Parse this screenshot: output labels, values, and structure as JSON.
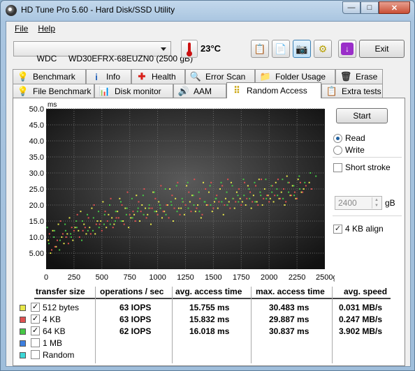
{
  "window": {
    "title": "HD Tune Pro 5.60 - Hard Disk/SSD Utility",
    "minimize_glyph": "—",
    "maximize_glyph": "□",
    "close_glyph": "✕"
  },
  "menu": {
    "file": "File",
    "help": "Help"
  },
  "toolbar": {
    "drive": "WDC     WD30EFRX-68EUZN0 (2500 gB)",
    "temperature": "23°C",
    "exit_label": "Exit",
    "buttons": [
      "copy-info-icon",
      "copy-screen-icon",
      "camera-icon",
      "options-icon",
      "download-icon"
    ]
  },
  "tabs_top": [
    {
      "label": "Benchmark",
      "icon": "benchmark-icon"
    },
    {
      "label": "Info",
      "icon": "info-icon"
    },
    {
      "label": "Health",
      "icon": "health-icon"
    },
    {
      "label": "Error Scan",
      "icon": "error-scan-icon"
    },
    {
      "label": "Folder Usage",
      "icon": "folder-icon"
    },
    {
      "label": "Erase",
      "icon": "trash-icon"
    }
  ],
  "tabs_bottom": [
    {
      "label": "File Benchmark",
      "icon": "file-benchmark-icon"
    },
    {
      "label": "Disk monitor",
      "icon": "disk-monitor-icon"
    },
    {
      "label": "AAM",
      "icon": "speaker-icon"
    },
    {
      "label": "Random Access",
      "icon": "random-access-icon",
      "selected": true
    },
    {
      "label": "Extra tests",
      "icon": "extra-tests-icon"
    }
  ],
  "controls": {
    "start_label": "Start",
    "read_label": "Read",
    "write_label": "Write",
    "mode": "Read",
    "short_stroke_label": "Short stroke",
    "short_stroke_checked": false,
    "short_stroke_value": "2400",
    "short_stroke_unit": "gB",
    "align_label": "4 KB align",
    "align_checked": true
  },
  "table": {
    "headers": {
      "transfer_size": "transfer size",
      "ops": "operations / sec",
      "avg_access": "avg. access time",
      "max_access": "max. access time",
      "avg_speed": "avg. speed"
    },
    "rows": [
      {
        "label": "512 bytes",
        "checked": true,
        "color": "#e8e84a",
        "ops": "63 IOPS",
        "avg": "15.755 ms",
        "max": "30.483 ms",
        "speed": "0.031 MB/s"
      },
      {
        "label": "4 KB",
        "checked": true,
        "color": "#e05050",
        "ops": "63 IOPS",
        "avg": "15.832 ms",
        "max": "29.887 ms",
        "speed": "0.247 MB/s"
      },
      {
        "label": "64 KB",
        "checked": true,
        "color": "#46c846",
        "ops": "62 IOPS",
        "avg": "16.018 ms",
        "max": "30.837 ms",
        "speed": "3.902 MB/s"
      },
      {
        "label": "1 MB",
        "checked": false,
        "color": "#3c7fe0",
        "ops": "",
        "avg": "",
        "max": "",
        "speed": ""
      },
      {
        "label": "Random",
        "checked": false,
        "color": "#3cd8d8",
        "ops": "",
        "avg": "",
        "max": "",
        "speed": ""
      }
    ]
  },
  "chart_data": {
    "type": "scatter",
    "y_unit": "ms",
    "x_unit": "gB",
    "ylim": [
      0,
      50
    ],
    "xlim": [
      0,
      2500
    ],
    "y_ticks": [
      "50.0",
      "45.0",
      "40.0",
      "35.0",
      "30.0",
      "25.0",
      "20.0",
      "15.0",
      "10.0",
      "5.00"
    ],
    "x_ticks": [
      "0",
      "250",
      "500",
      "750",
      "1000",
      "1250",
      "1500",
      "1750",
      "2000",
      "2250",
      "2500gB"
    ],
    "grid": true,
    "series": [
      {
        "color": "#e8e84a",
        "points": [
          [
            20,
            9
          ],
          [
            60,
            12
          ],
          [
            110,
            14
          ],
          [
            160,
            8
          ],
          [
            210,
            16
          ],
          [
            260,
            13
          ],
          [
            310,
            18
          ],
          [
            360,
            11
          ],
          [
            410,
            19
          ],
          [
            460,
            15
          ],
          [
            510,
            21
          ],
          [
            560,
            17
          ],
          [
            610,
            14
          ],
          [
            660,
            22
          ],
          [
            710,
            19
          ],
          [
            760,
            16
          ],
          [
            810,
            23
          ],
          [
            860,
            20
          ],
          [
            910,
            17
          ],
          [
            960,
            24
          ],
          [
            1010,
            21
          ],
          [
            1060,
            18
          ],
          [
            1110,
            25
          ],
          [
            1160,
            22
          ],
          [
            1210,
            19
          ],
          [
            1260,
            26
          ],
          [
            1310,
            23
          ],
          [
            1360,
            20
          ],
          [
            1410,
            27
          ],
          [
            1460,
            24
          ],
          [
            1510,
            21
          ],
          [
            1560,
            25
          ],
          [
            1610,
            22
          ],
          [
            1660,
            27
          ],
          [
            1710,
            24
          ],
          [
            1760,
            21
          ],
          [
            1810,
            26
          ],
          [
            1860,
            23
          ],
          [
            1910,
            28
          ],
          [
            1960,
            25
          ],
          [
            2010,
            22
          ],
          [
            2060,
            27
          ],
          [
            2110,
            24
          ],
          [
            2160,
            29
          ],
          [
            2210,
            26
          ],
          [
            2260,
            28
          ],
          [
            2310,
            25
          ],
          [
            2360,
            27
          ],
          [
            40,
            5
          ],
          [
            90,
            7
          ],
          [
            140,
            10
          ],
          [
            190,
            11
          ],
          [
            240,
            9
          ],
          [
            290,
            12
          ],
          [
            340,
            14
          ],
          [
            390,
            13
          ],
          [
            440,
            11
          ],
          [
            490,
            15
          ],
          [
            540,
            13
          ],
          [
            590,
            16
          ],
          [
            640,
            18
          ],
          [
            690,
            15
          ],
          [
            740,
            13
          ],
          [
            790,
            17
          ],
          [
            840,
            15
          ],
          [
            890,
            19
          ],
          [
            940,
            14
          ],
          [
            990,
            18
          ],
          [
            1040,
            16
          ],
          [
            1090,
            20
          ],
          [
            1140,
            15
          ],
          [
            1190,
            19
          ],
          [
            1240,
            17
          ],
          [
            1290,
            21
          ],
          [
            1340,
            18
          ],
          [
            1390,
            16
          ],
          [
            1440,
            20
          ],
          [
            1490,
            18
          ],
          [
            1540,
            19
          ],
          [
            1590,
            17
          ],
          [
            1640,
            21
          ],
          [
            1690,
            19
          ],
          [
            1740,
            22
          ],
          [
            1790,
            20
          ],
          [
            1840,
            19
          ],
          [
            1890,
            21
          ],
          [
            1940,
            20
          ],
          [
            1990,
            23
          ],
          [
            2040,
            21
          ],
          [
            2090,
            22
          ],
          [
            2140,
            20
          ],
          [
            2190,
            23
          ],
          [
            2240,
            22
          ],
          [
            2290,
            24
          ]
        ]
      },
      {
        "color": "#e05050",
        "points": [
          [
            30,
            11
          ],
          [
            80,
            7
          ],
          [
            130,
            15
          ],
          [
            180,
            10
          ],
          [
            230,
            13
          ],
          [
            280,
            17
          ],
          [
            330,
            12
          ],
          [
            380,
            16
          ],
          [
            430,
            20
          ],
          [
            480,
            14
          ],
          [
            530,
            18
          ],
          [
            580,
            22
          ],
          [
            630,
            16
          ],
          [
            680,
            20
          ],
          [
            730,
            24
          ],
          [
            780,
            18
          ],
          [
            830,
            21
          ],
          [
            880,
            25
          ],
          [
            930,
            19
          ],
          [
            980,
            22
          ],
          [
            1030,
            26
          ],
          [
            1080,
            20
          ],
          [
            1130,
            23
          ],
          [
            1180,
            27
          ],
          [
            1230,
            21
          ],
          [
            1280,
            24
          ],
          [
            1330,
            28
          ],
          [
            1380,
            22
          ],
          [
            1430,
            25
          ],
          [
            1480,
            27
          ],
          [
            1530,
            23
          ],
          [
            1580,
            26
          ],
          [
            1630,
            28
          ],
          [
            1680,
            22
          ],
          [
            1730,
            25
          ],
          [
            1780,
            27
          ],
          [
            1830,
            24
          ],
          [
            1880,
            26
          ],
          [
            1930,
            28
          ],
          [
            1980,
            23
          ],
          [
            2030,
            26
          ],
          [
            2080,
            28
          ],
          [
            2130,
            25
          ],
          [
            2180,
            27
          ],
          [
            2230,
            24
          ],
          [
            2280,
            27
          ],
          [
            2330,
            26
          ],
          [
            2380,
            25
          ],
          [
            50,
            6
          ],
          [
            100,
            9
          ],
          [
            150,
            11
          ],
          [
            200,
            8
          ],
          [
            250,
            12
          ],
          [
            300,
            10
          ],
          [
            350,
            13
          ],
          [
            400,
            11
          ],
          [
            450,
            14
          ],
          [
            500,
            12
          ],
          [
            550,
            15
          ],
          [
            600,
            13
          ],
          [
            650,
            16
          ],
          [
            700,
            14
          ],
          [
            750,
            17
          ],
          [
            800,
            15
          ],
          [
            850,
            18
          ],
          [
            900,
            16
          ],
          [
            950,
            19
          ],
          [
            1000,
            17
          ],
          [
            1050,
            18
          ],
          [
            1100,
            16
          ],
          [
            1150,
            19
          ],
          [
            1200,
            17
          ],
          [
            1250,
            20
          ],
          [
            1300,
            18
          ],
          [
            1350,
            19
          ],
          [
            1400,
            17
          ],
          [
            1450,
            20
          ],
          [
            1500,
            19
          ],
          [
            1550,
            21
          ],
          [
            1600,
            20
          ],
          [
            1650,
            19
          ],
          [
            1700,
            21
          ],
          [
            1750,
            20
          ],
          [
            1800,
            22
          ],
          [
            1850,
            21
          ],
          [
            1900,
            20
          ],
          [
            1950,
            22
          ],
          [
            2000,
            21
          ],
          [
            2050,
            23
          ],
          [
            2100,
            22
          ],
          [
            2150,
            21
          ],
          [
            2200,
            23
          ],
          [
            2250,
            22
          ],
          [
            2300,
            24
          ]
        ]
      },
      {
        "color": "#46c846",
        "points": [
          [
            10,
            13
          ],
          [
            70,
            10
          ],
          [
            120,
            6
          ],
          [
            170,
            14
          ],
          [
            220,
            11
          ],
          [
            270,
            15
          ],
          [
            320,
            9
          ],
          [
            370,
            17
          ],
          [
            420,
            12
          ],
          [
            470,
            18
          ],
          [
            520,
            14
          ],
          [
            570,
            20
          ],
          [
            620,
            15
          ],
          [
            670,
            21
          ],
          [
            720,
            17
          ],
          [
            770,
            22
          ],
          [
            820,
            18
          ],
          [
            870,
            23
          ],
          [
            920,
            19
          ],
          [
            970,
            24
          ],
          [
            1020,
            20
          ],
          [
            1070,
            25
          ],
          [
            1120,
            21
          ],
          [
            1170,
            26
          ],
          [
            1220,
            22
          ],
          [
            1270,
            27
          ],
          [
            1320,
            23
          ],
          [
            1370,
            24
          ],
          [
            1420,
            21
          ],
          [
            1470,
            26
          ],
          [
            1520,
            22
          ],
          [
            1570,
            27
          ],
          [
            1620,
            24
          ],
          [
            1670,
            26
          ],
          [
            1720,
            23
          ],
          [
            1770,
            28
          ],
          [
            1820,
            25
          ],
          [
            1870,
            27
          ],
          [
            1920,
            24
          ],
          [
            1970,
            28
          ],
          [
            2020,
            26
          ],
          [
            2070,
            25
          ],
          [
            2120,
            28
          ],
          [
            2170,
            27
          ],
          [
            2220,
            26
          ],
          [
            2270,
            29
          ],
          [
            2320,
            27
          ],
          [
            2370,
            30
          ],
          [
            2420,
            29
          ],
          [
            25,
            8
          ],
          [
            75,
            12
          ],
          [
            125,
            9
          ],
          [
            175,
            12
          ],
          [
            225,
            10
          ],
          [
            275,
            13
          ],
          [
            325,
            15
          ],
          [
            375,
            12
          ],
          [
            425,
            16
          ],
          [
            475,
            13
          ],
          [
            525,
            17
          ],
          [
            575,
            14
          ],
          [
            625,
            18
          ],
          [
            675,
            15
          ],
          [
            725,
            19
          ],
          [
            775,
            16
          ],
          [
            825,
            19
          ],
          [
            875,
            17
          ],
          [
            925,
            20
          ],
          [
            975,
            18
          ],
          [
            1025,
            19
          ],
          [
            1075,
            17
          ],
          [
            1125,
            20
          ],
          [
            1175,
            18
          ],
          [
            1225,
            21
          ],
          [
            1275,
            19
          ],
          [
            1325,
            20
          ],
          [
            1375,
            18
          ],
          [
            1425,
            21
          ],
          [
            1475,
            20
          ],
          [
            1525,
            22
          ],
          [
            1575,
            21
          ],
          [
            1625,
            20
          ],
          [
            1675,
            22
          ],
          [
            1725,
            21
          ],
          [
            1775,
            23
          ],
          [
            1825,
            22
          ],
          [
            1875,
            21
          ],
          [
            1925,
            23
          ],
          [
            1975,
            22
          ],
          [
            2025,
            24
          ],
          [
            2075,
            23
          ],
          [
            2125,
            22
          ],
          [
            2175,
            24
          ],
          [
            2225,
            23
          ],
          [
            2275,
            25
          ]
        ]
      }
    ]
  }
}
